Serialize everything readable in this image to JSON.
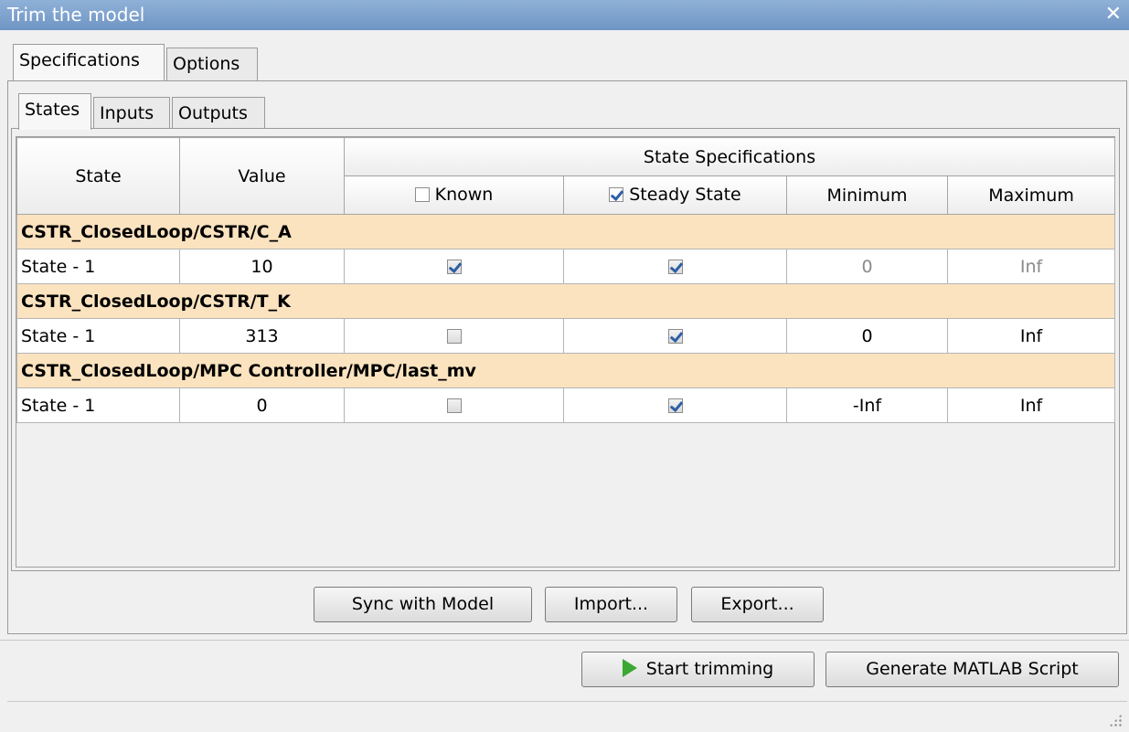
{
  "window": {
    "title": "Trim the model",
    "close_glyph": "✕"
  },
  "tabs": [
    {
      "label": "Specifications"
    },
    {
      "label": "Options"
    }
  ],
  "subtabs": [
    {
      "label": "States"
    },
    {
      "label": "Inputs"
    },
    {
      "label": "Outputs"
    }
  ],
  "table": {
    "headers": {
      "state": "State",
      "value": "Value",
      "group": "State Specifications",
      "known": "Known",
      "steady_state": "Steady State",
      "minimum": "Minimum",
      "maximum": "Maximum"
    },
    "header_checks": {
      "known": false,
      "steady_state": true
    },
    "groups": [
      {
        "block": "CSTR_ClosedLoop/CSTR/C_A",
        "row": {
          "state": "State - 1",
          "value": "10",
          "known": true,
          "steady_state": true,
          "minimum": "0",
          "maximum": "Inf",
          "bounds_muted": true
        }
      },
      {
        "block": "CSTR_ClosedLoop/CSTR/T_K",
        "row": {
          "state": "State - 1",
          "value": "313",
          "known": false,
          "steady_state": true,
          "minimum": "0",
          "maximum": "Inf",
          "bounds_muted": false
        }
      },
      {
        "block": "CSTR_ClosedLoop/MPC Controller/MPC/last_mv",
        "row": {
          "state": "State - 1",
          "value": "0",
          "known": false,
          "steady_state": true,
          "minimum": "-Inf",
          "maximum": "Inf",
          "bounds_muted": false
        }
      }
    ]
  },
  "buttons": {
    "sync": "Sync with Model",
    "import": "Import...",
    "export": "Export...",
    "start_trimming": "Start trimming",
    "generate_script": "Generate MATLAB Script"
  },
  "colors": {
    "group_row": "#fbe3bf",
    "play_icon": "#3aa832",
    "checkmark": "#2d5fa5"
  }
}
